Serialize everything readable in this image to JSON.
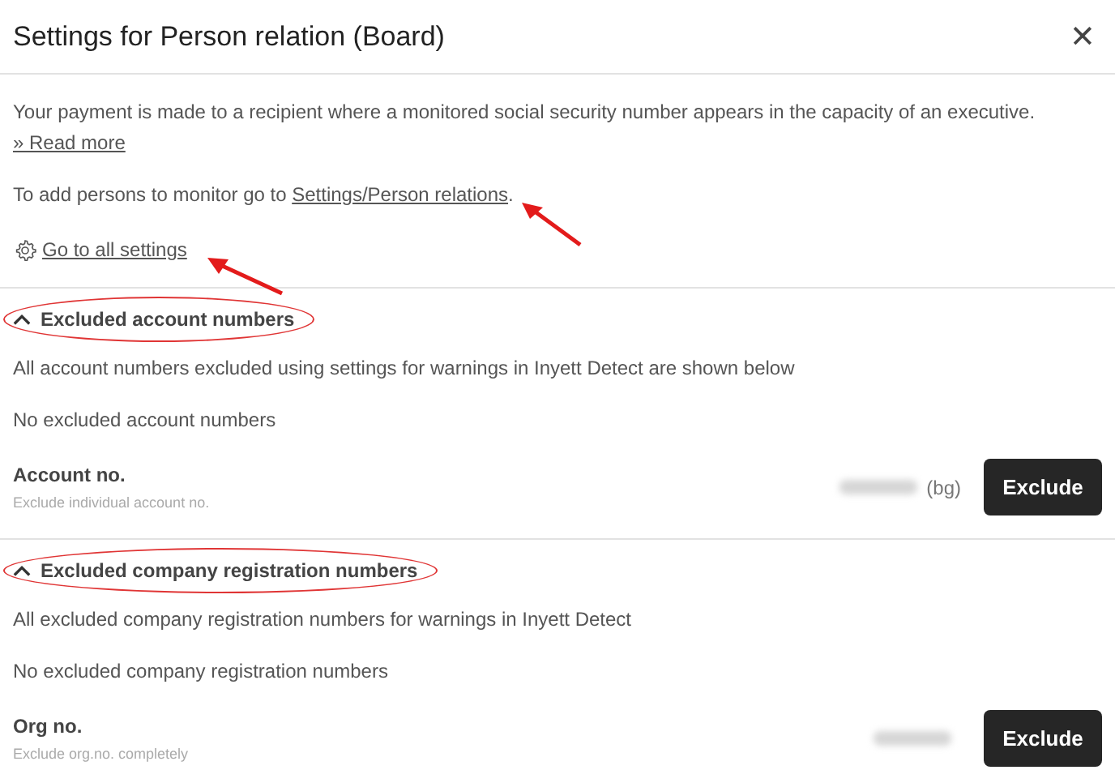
{
  "dialog": {
    "title": "Settings for Person relation (Board)",
    "close": "✕"
  },
  "intro": {
    "text": "Your payment is made to a recipient where a monitored social security number appears in the capacity of an executive.",
    "read_more": "» Read more",
    "monitor_text": "To add persons to monitor go to",
    "monitor_link": {
      "label": "Settings/Person relations",
      "arrow": true
    },
    "monitor_end": ".",
    "settings_link": {
      "label": "Go to all settings",
      "arrow": true
    }
  },
  "sections": [
    {
      "title": "Excluded account numbers",
      "expanded": true,
      "highlighted": true,
      "description": "All account numbers excluded using settings for warnings in Inyett Detect are shown below",
      "empty_text": "No excluded account numbers",
      "field_label": "Account no.",
      "field_hint": "Exclude individual account no.",
      "value_suffix": "(bg)",
      "button": "Exclude"
    },
    {
      "title": "Excluded company registration numbers",
      "expanded": true,
      "highlighted": true,
      "description": "All excluded company registration numbers for warnings in Inyett Detect",
      "empty_text": "No excluded company registration numbers",
      "field_label": "Org no.",
      "field_hint": "Exclude org.no. completely",
      "button": "Exclude"
    }
  ]
}
